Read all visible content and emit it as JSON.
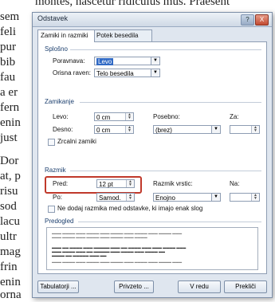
{
  "document": {
    "top_line": "montes, nascetur ridiculus mus. Praesent",
    "left_fragments": [
      "sem",
      "feli",
      "pur",
      "bib",
      "fau",
      "a er",
      "fern",
      "enin",
      "just",
      "Dor",
      "at, p",
      "risu",
      "sod",
      "lacu",
      "ultr",
      "mag",
      "frin",
      "enin",
      "orna"
    ]
  },
  "dialog": {
    "title": "Odstavek",
    "help_label": "?",
    "close_label": "X",
    "tabs": [
      "Zamiki in razmiki",
      "Potek besedila"
    ],
    "splosno": {
      "title": "Splošno",
      "poravnava_label": "Poravnava:",
      "poravnava_value": "Levo",
      "raven_label": "Orisna raven:",
      "raven_value": "Telo besedila"
    },
    "zamikanje": {
      "title": "Zamikanje",
      "levo_label": "Levo:",
      "levo_value": "0 cm",
      "desno_label": "Desno:",
      "desno_value": "0 cm",
      "posebno_label": "Posebno:",
      "posebno_value": "(brez)",
      "za_label": "Za:",
      "zrcalni_label": "Zrcalni zamiki"
    },
    "razmik": {
      "title": "Razmik",
      "pred_label": "Pred:",
      "pred_value": "12 pt",
      "po_label": "Po:",
      "po_value": "Samod.",
      "vrstic_label": "Razmik vrstic:",
      "vrstic_value": "Enojno",
      "na_label": "Na:",
      "nedodaj_label": "Ne dodaj razmika med odstavke, ki imajo enak slog"
    },
    "predogled": {
      "title": "Predogled"
    },
    "buttons": {
      "tabulatorji": "Tabulatorji ...",
      "privzeto": "Privzeto ...",
      "vredu": "V redu",
      "preklici": "Prekliči"
    }
  }
}
